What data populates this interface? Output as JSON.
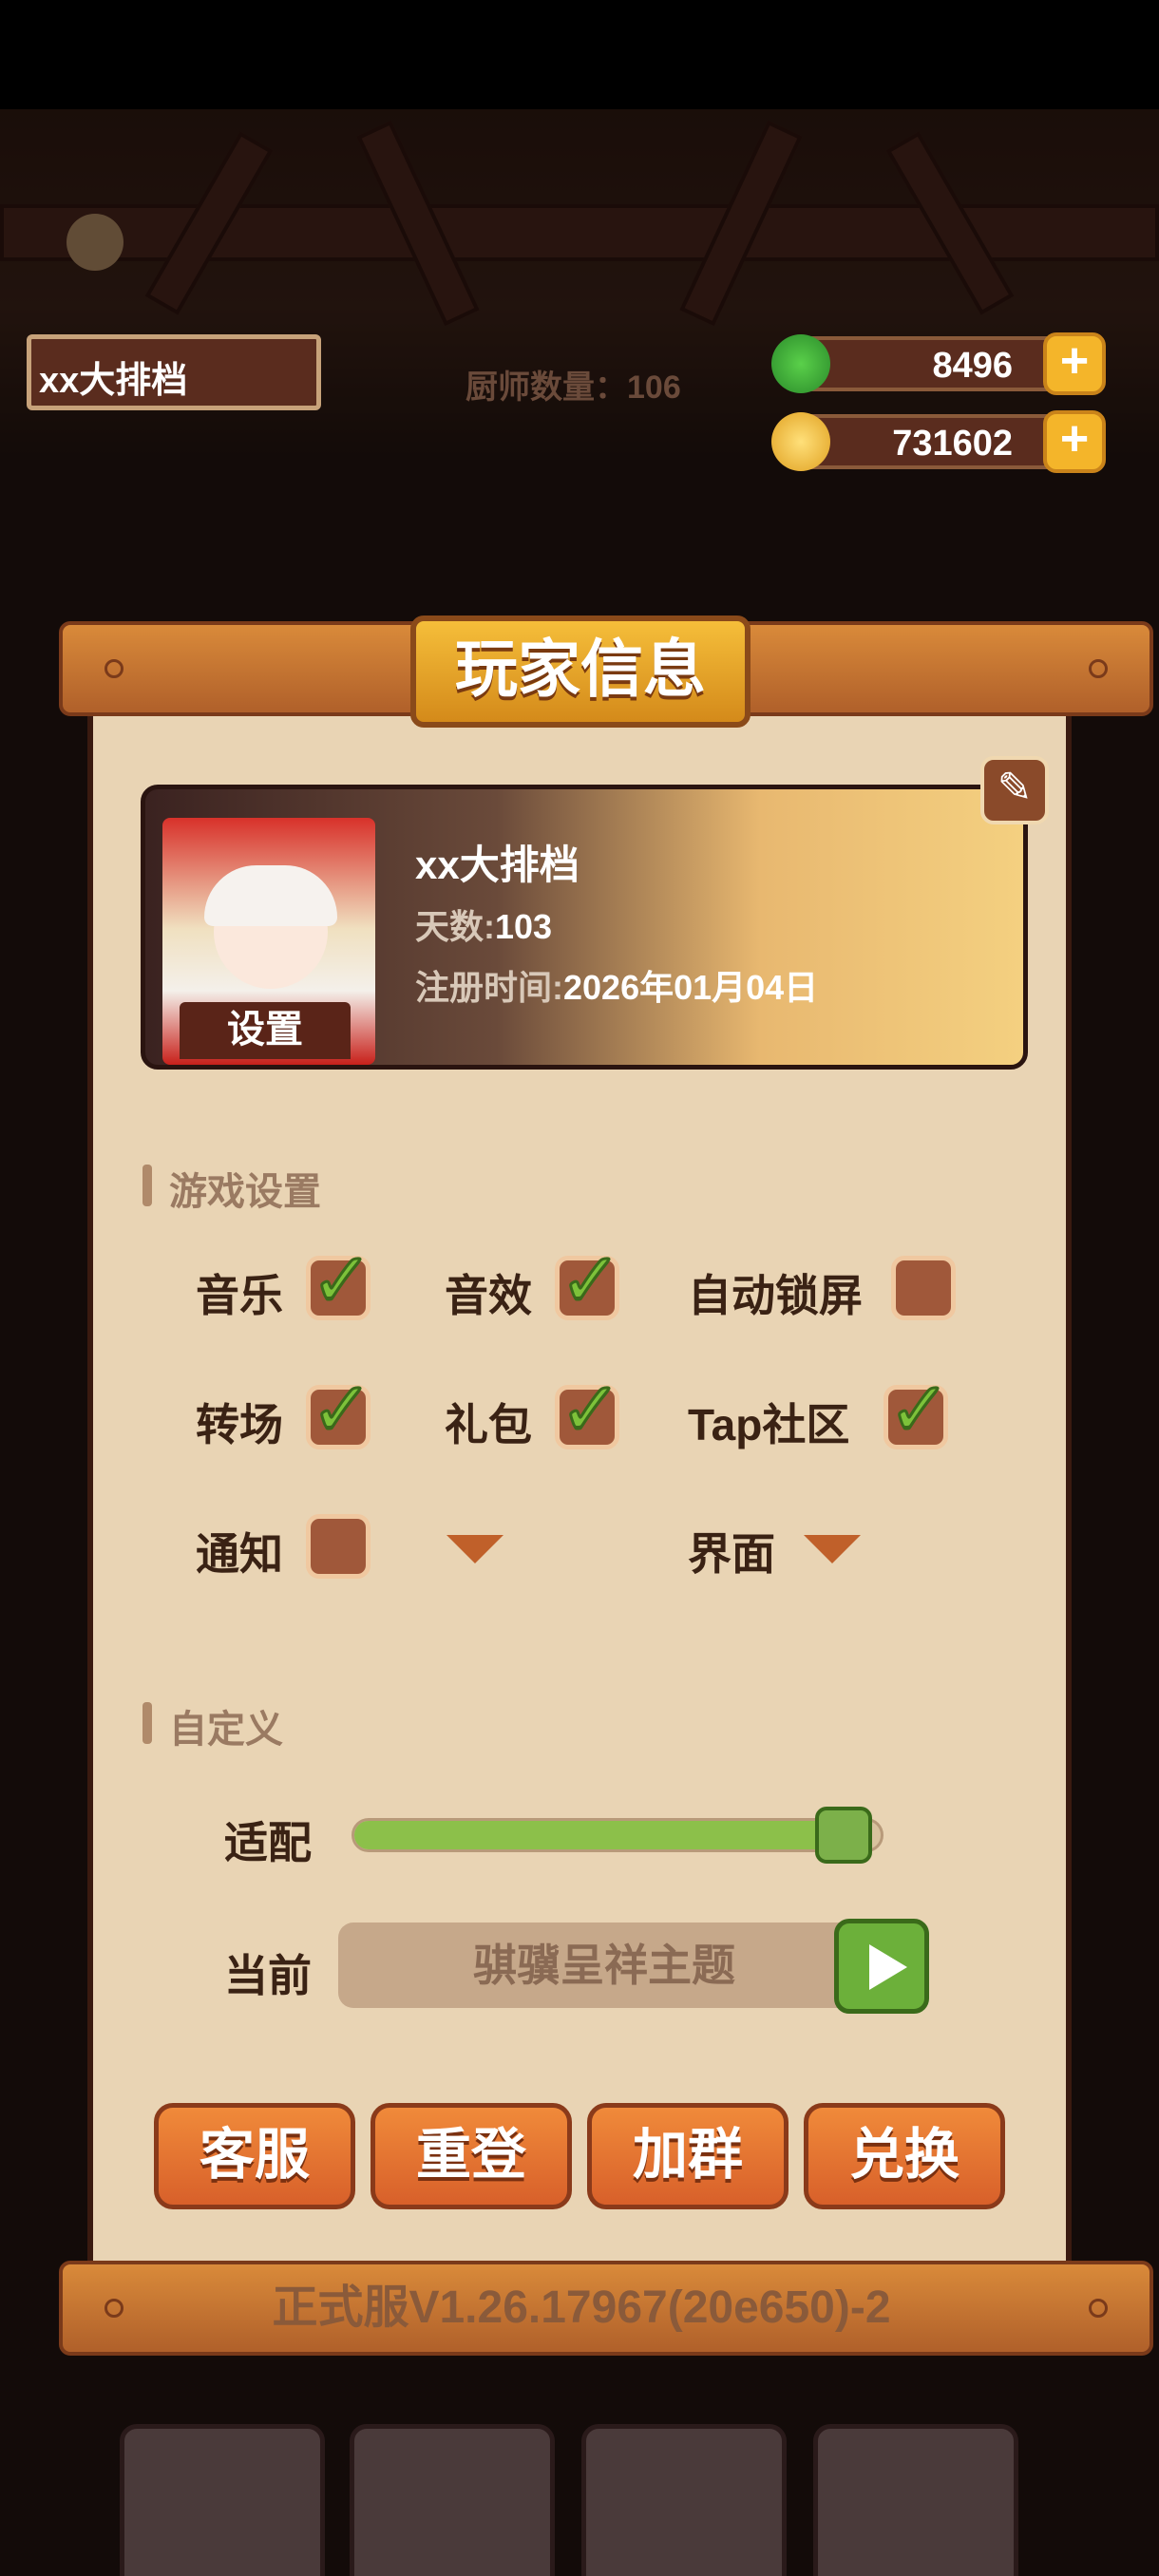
{
  "hud": {
    "shop_name": "xx大排档",
    "chef_count": "厨师数量：106",
    "jade": "8496",
    "coins": "731602",
    "plus_icon": "+"
  },
  "panel": {
    "title": "玩家信息",
    "profile": {
      "name": "xx大排档",
      "days_label": "天数:",
      "days": "103",
      "reg_label": "注册时间:",
      "reg_date": "2026年01月04日",
      "avatar_button": "设置"
    },
    "game_settings": {
      "heading": "游戏设置",
      "options": [
        {
          "label": "音乐",
          "checked": true
        },
        {
          "label": "音效",
          "checked": true
        },
        {
          "label": "自动锁屏",
          "checked": false
        },
        {
          "label": "转场",
          "checked": true
        },
        {
          "label": "礼包",
          "checked": true
        },
        {
          "label": "Tap社区",
          "checked": true
        },
        {
          "label": "通知",
          "checked": false
        }
      ],
      "interface_label": "界面"
    },
    "custom": {
      "heading": "自定义",
      "adapt_label": "适配",
      "adapt_value": 0.93,
      "current_label": "当前",
      "theme_name": "骐骥呈祥主题"
    },
    "buttons": [
      "客服",
      "重登",
      "加群",
      "兑换"
    ],
    "version": "正式服V1.26.17967(20e650)-2"
  },
  "colors": {
    "accent": "#f4b52a",
    "panel_bg": "#e9d4b4",
    "check_green": "#7dc23a",
    "button_orange": "#e8742f"
  }
}
